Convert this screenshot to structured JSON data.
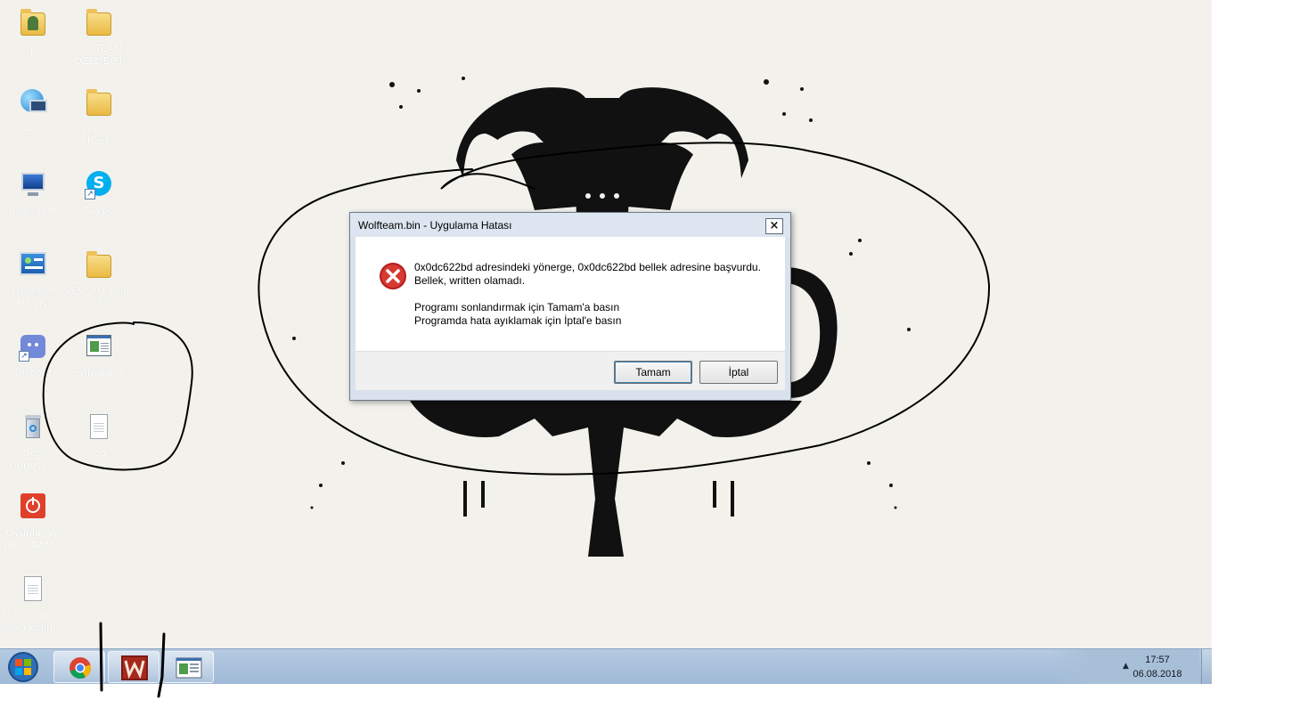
{
  "desktop": {
    "icons": [
      {
        "label": "esper",
        "icon": "user-folder-icon"
      },
      {
        "label": "HDLTEAM ÖZEL BOT",
        "icon": "folder-icon"
      },
      {
        "label": "Ağ",
        "icon": "network-icon"
      },
      {
        "label": "Hilgmice hack",
        "icon": "folder-icon"
      },
      {
        "label": "Bilgisayar",
        "icon": "computer-icon"
      },
      {
        "label": "Skype",
        "icon": "skype-icon"
      },
      {
        "label": "Denetim Masası",
        "icon": "control-panel-icon"
      },
      {
        "label": "PES 2013 File Editor",
        "icon": "folder-icon"
      },
      {
        "label": "Discord",
        "icon": "discord-icon"
      },
      {
        "label": "eyjmwwob",
        "icon": "app-window-icon"
      },
      {
        "label": "Geri Dönüşü...",
        "icon": "recycle-bin-icon"
      },
      {
        "label": "log",
        "icon": "text-file-icon"
      },
      {
        "label": "Oyunlar Ve PROGRAM...",
        "icon": "power-app-icon"
      },
      {
        "label": "Unutmamak İçin Yazdığı...",
        "icon": "text-file-icon"
      }
    ]
  },
  "dialog": {
    "title": "Wolfteam.bin - Uygulama Hatası",
    "close_label": "×",
    "message_line1": "0x0dc622bd adresindeki yönerge, 0x0dc622bd bellek adresine başvurdu.",
    "message_line2": "Bellek, written olamadı.",
    "message_line3": "Programı sonlandırmak için Tamam'a basın",
    "message_line4": "Programda hata ayıklamak için İptal'e basın",
    "ok_label": "Tamam",
    "cancel_label": "İptal",
    "icon": "error-icon"
  },
  "taskbar": {
    "start_icon": "windows-start-icon",
    "pinned": [
      {
        "name": "chrome",
        "icon": "chrome-icon"
      },
      {
        "name": "wolfteam",
        "icon": "wolfteam-icon"
      },
      {
        "name": "app",
        "icon": "app-window-icon"
      }
    ],
    "clock_time": "17:57",
    "clock_date": "06.08.2018"
  },
  "colors": {
    "error_red": "#d0272a",
    "taskbar": "#a9c1db",
    "desktop_bg": "#f2f1ec"
  }
}
